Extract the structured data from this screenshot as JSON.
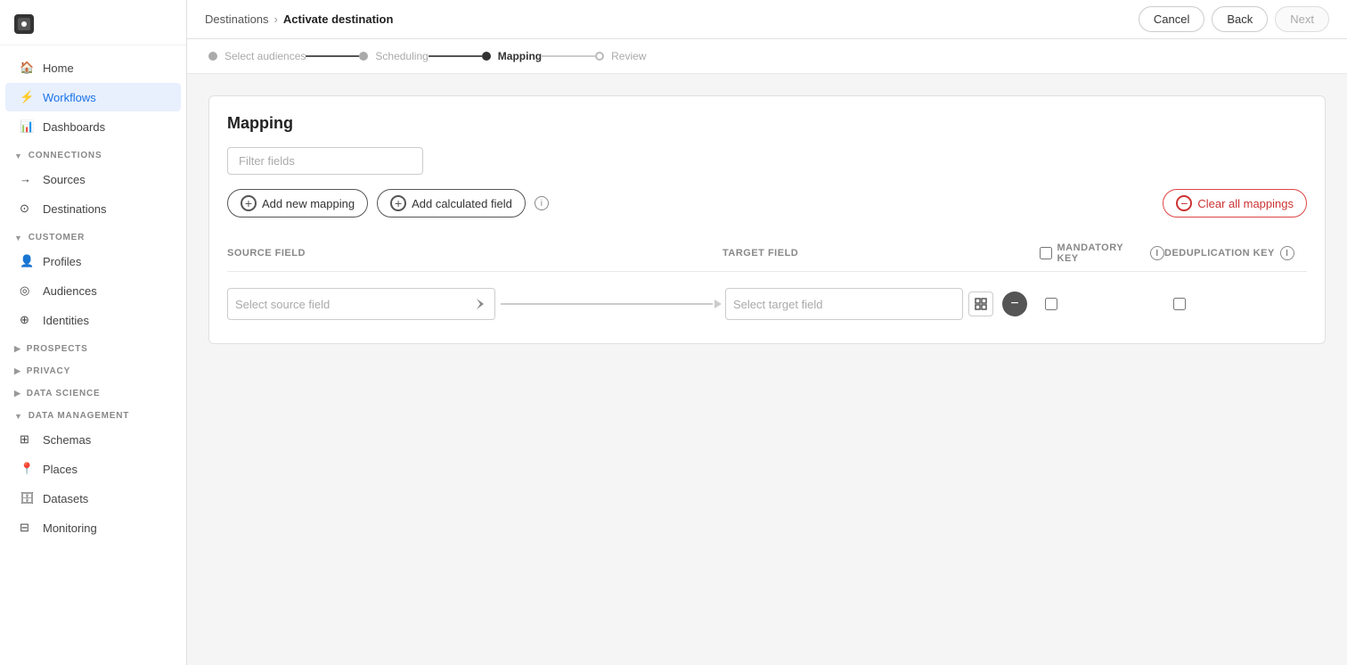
{
  "sidebar": {
    "nav": [
      {
        "id": "home",
        "label": "Home",
        "icon": "🏠",
        "active": false
      },
      {
        "id": "workflows",
        "label": "Workflows",
        "icon": "⚡",
        "active": true
      }
    ],
    "general": [
      {
        "id": "dashboards",
        "label": "Dashboards",
        "icon": "📊",
        "active": false
      }
    ],
    "sections": [
      {
        "id": "connections",
        "label": "CONNECTIONS",
        "expanded": true,
        "items": [
          {
            "id": "sources",
            "label": "Sources",
            "icon": "→",
            "active": false
          },
          {
            "id": "destinations",
            "label": "Destinations",
            "icon": "⊙",
            "active": false
          }
        ]
      },
      {
        "id": "customer",
        "label": "CUSTOMER",
        "expanded": true,
        "items": [
          {
            "id": "profiles",
            "label": "Profiles",
            "icon": "👤",
            "active": false
          },
          {
            "id": "audiences",
            "label": "Audiences",
            "icon": "◎",
            "active": false
          },
          {
            "id": "identities",
            "label": "Identities",
            "icon": "⊕",
            "active": false
          }
        ]
      },
      {
        "id": "prospects",
        "label": "PROSPECTS",
        "expanded": false,
        "items": []
      },
      {
        "id": "privacy",
        "label": "PRIVACY",
        "expanded": false,
        "items": []
      },
      {
        "id": "data_science",
        "label": "DATA SCIENCE",
        "expanded": false,
        "items": []
      },
      {
        "id": "data_management",
        "label": "DATA MANAGEMENT",
        "expanded": true,
        "items": [
          {
            "id": "schemas",
            "label": "Schemas",
            "icon": "⊞",
            "active": false
          },
          {
            "id": "places",
            "label": "Places",
            "icon": "📍",
            "active": false
          },
          {
            "id": "datasets",
            "label": "Datasets",
            "icon": "🗄",
            "active": false
          },
          {
            "id": "monitoring",
            "label": "Monitoring",
            "icon": "⊟",
            "active": false
          }
        ]
      }
    ]
  },
  "topbar": {
    "breadcrumb_parent": "Destinations",
    "breadcrumb_separator": "›",
    "breadcrumb_current": "Activate destination",
    "cancel_label": "Cancel",
    "back_label": "Back",
    "next_label": "Next"
  },
  "stepper": {
    "steps": [
      {
        "id": "select-audiences",
        "label": "Select audiences",
        "state": "done"
      },
      {
        "id": "scheduling",
        "label": "Scheduling",
        "state": "done"
      },
      {
        "id": "mapping",
        "label": "Mapping",
        "state": "active"
      },
      {
        "id": "review",
        "label": "Review",
        "state": "review"
      }
    ]
  },
  "mapping": {
    "title": "Mapping",
    "filter_placeholder": "Filter fields",
    "add_mapping_label": "Add new mapping",
    "add_calculated_label": "Add calculated field",
    "clear_all_label": "Clear all mappings",
    "source_field_header": "SOURCE FIELD",
    "target_field_header": "TARGET FIELD",
    "mandatory_key_header": "MANDATORY KEY",
    "deduplication_key_header": "DEDUPLICATION KEY",
    "rows": [
      {
        "source_placeholder": "Select source field",
        "target_placeholder": "Select target field"
      }
    ]
  }
}
